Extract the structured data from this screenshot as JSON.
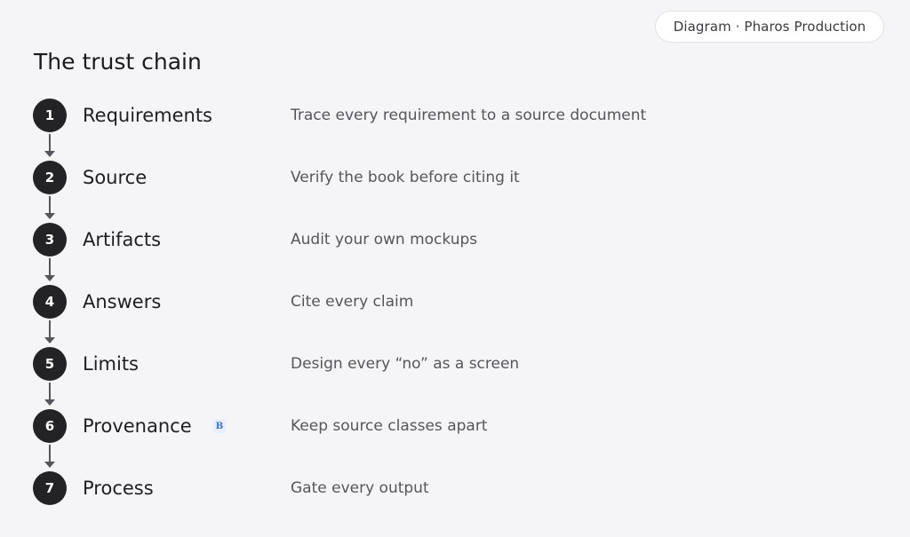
{
  "badge": "Diagram · Pharos Production",
  "title": "The trust chain",
  "steps": [
    {
      "number": "1",
      "label": "Requirements",
      "description": "Trace every requirement to a source document"
    },
    {
      "number": "2",
      "label": "Source",
      "description": "Verify the book before citing it"
    },
    {
      "number": "3",
      "label": "Artifacts",
      "description": "Audit your own mockups"
    },
    {
      "number": "4",
      "label": "Answers",
      "description": "Cite every claim"
    },
    {
      "number": "5",
      "label": "Limits",
      "description": "Design every “no” as a screen"
    },
    {
      "number": "6",
      "label": "Provenance",
      "tag": "B",
      "description": "Keep source classes apart"
    },
    {
      "number": "7",
      "label": "Process",
      "description": "Gate every output"
    }
  ]
}
